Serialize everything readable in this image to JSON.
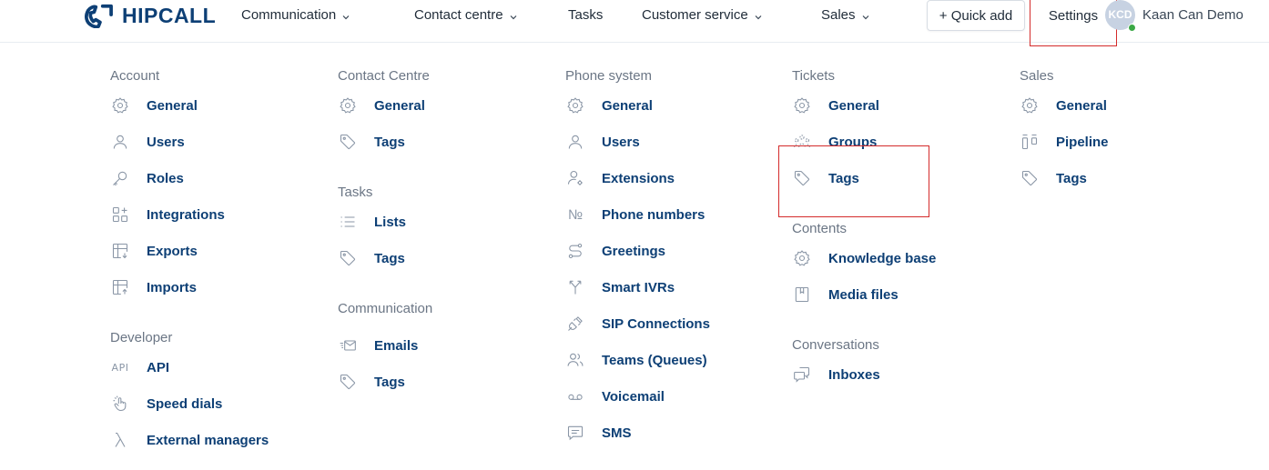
{
  "brand": {
    "name": "HIPCALL"
  },
  "nav": {
    "communication": "Communication",
    "contact_centre": "Contact centre",
    "tasks": "Tasks",
    "customer_service": "Customer service",
    "sales": "Sales",
    "quick_add": "+ Quick add",
    "settings": "Settings"
  },
  "user": {
    "initials": "KCD",
    "name": "Kaan Can Demo",
    "status_color": "#3aa845"
  },
  "colors": {
    "accent": "#0d3f75",
    "highlight": "#d42b2b",
    "muted": "#6b7685"
  },
  "sections": {
    "account": {
      "title": "Account",
      "items": [
        {
          "label": "General",
          "icon": "gear-icon"
        },
        {
          "label": "Users",
          "icon": "user-icon"
        },
        {
          "label": "Roles",
          "icon": "key-icon"
        },
        {
          "label": "Integrations",
          "icon": "grid-plus-icon"
        },
        {
          "label": "Exports",
          "icon": "table-export-icon"
        },
        {
          "label": "Imports",
          "icon": "table-import-icon"
        }
      ]
    },
    "developer": {
      "title": "Developer",
      "items": [
        {
          "label": "API",
          "icon": "api-icon",
          "icon_text": "API"
        },
        {
          "label": "Speed dials",
          "icon": "tap-icon"
        },
        {
          "label": "External managers",
          "icon": "lambda-icon"
        }
      ]
    },
    "contact_centre": {
      "title": "Contact Centre",
      "items": [
        {
          "label": "General",
          "icon": "gear-icon"
        },
        {
          "label": "Tags",
          "icon": "tag-icon"
        }
      ]
    },
    "tasks": {
      "title": "Tasks",
      "items": [
        {
          "label": "Lists",
          "icon": "list-icon"
        },
        {
          "label": "Tags",
          "icon": "tag-icon"
        }
      ]
    },
    "communication": {
      "title": "Communication",
      "items": [
        {
          "label": "Emails",
          "icon": "email-icon"
        },
        {
          "label": "Tags",
          "icon": "tag-icon"
        }
      ]
    },
    "phone_system": {
      "title": "Phone system",
      "items": [
        {
          "label": "General",
          "icon": "gear-icon"
        },
        {
          "label": "Users",
          "icon": "user-icon"
        },
        {
          "label": "Extensions",
          "icon": "user-gear-icon"
        },
        {
          "label": "Phone numbers",
          "icon": "number-sign-icon",
          "icon_text": "№"
        },
        {
          "label": "Greetings",
          "icon": "route-icon"
        },
        {
          "label": "Smart IVRs",
          "icon": "split-arrow-icon"
        },
        {
          "label": "SIP Connections",
          "icon": "plug-icon"
        },
        {
          "label": "Teams (Queues)",
          "icon": "team-icon"
        },
        {
          "label": "Voicemail",
          "icon": "voicemail-icon"
        },
        {
          "label": "SMS",
          "icon": "message-icon"
        }
      ]
    },
    "tickets": {
      "title": "Tickets",
      "items": [
        {
          "label": "General",
          "icon": "gear-icon"
        },
        {
          "label": "Groups",
          "icon": "group-icon"
        },
        {
          "label": "Tags",
          "icon": "tag-icon"
        }
      ]
    },
    "contents": {
      "title": "Contents",
      "items": [
        {
          "label": "Knowledge base",
          "icon": "gear-icon"
        },
        {
          "label": "Media files",
          "icon": "bookmark-icon"
        }
      ]
    },
    "conversations": {
      "title": "Conversations",
      "items": [
        {
          "label": "Inboxes",
          "icon": "chat-icon"
        }
      ]
    },
    "sales": {
      "title": "Sales",
      "items": [
        {
          "label": "General",
          "icon": "gear-icon"
        },
        {
          "label": "Pipeline",
          "icon": "pipeline-icon"
        },
        {
          "label": "Tags",
          "icon": "tag-icon"
        }
      ]
    }
  }
}
